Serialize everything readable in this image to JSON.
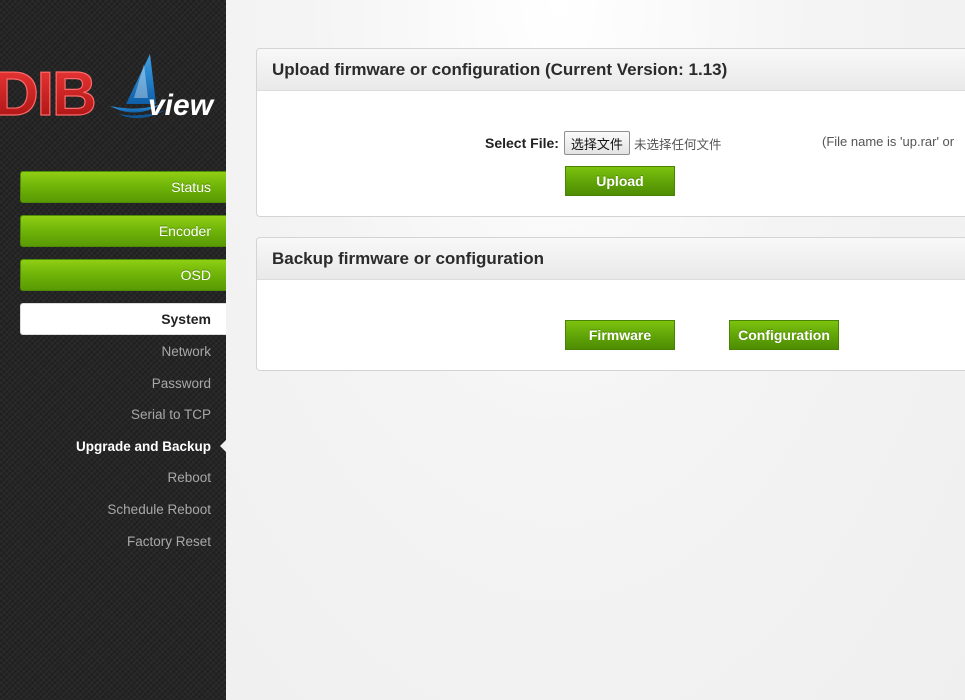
{
  "logo": {
    "text_main": "DIB",
    "text_sub": "view",
    "colors": {
      "red": "#d81e1e",
      "blue": "#1a7cc9"
    }
  },
  "sidebar": {
    "menu": [
      {
        "label": "Status",
        "active": false
      },
      {
        "label": "Encoder",
        "active": false
      },
      {
        "label": "OSD",
        "active": false
      },
      {
        "label": "System",
        "active": true
      }
    ],
    "submenu": [
      {
        "label": "Network"
      },
      {
        "label": "Password"
      },
      {
        "label": "Serial to TCP"
      },
      {
        "label": "Upgrade and Backup",
        "active": true
      },
      {
        "label": "Reboot"
      },
      {
        "label": "Schedule Reboot"
      },
      {
        "label": "Factory Reset"
      }
    ]
  },
  "upload_panel": {
    "title": "Upload firmware or configuration (Current Version: 1.13)",
    "select_file_label": "Select File:",
    "choose_file_button": "选择文件",
    "file_status": "未选择任何文件",
    "file_hint": "(File name is 'up.rar' or",
    "upload_button": "Upload"
  },
  "backup_panel": {
    "title": "Backup firmware or configuration",
    "firmware_button": "Firmware",
    "configuration_button": "Configuration"
  },
  "colors": {
    "accent_green": "#6eb308",
    "sidebar_bg": "#262626"
  }
}
